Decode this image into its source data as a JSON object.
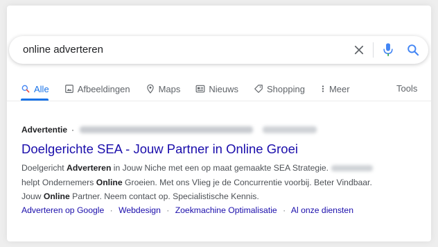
{
  "search": {
    "query": "online adverteren"
  },
  "tabs": [
    {
      "label": "Alle",
      "icon": "search-icon",
      "active": true
    },
    {
      "label": "Afbeeldingen",
      "icon": "image-icon"
    },
    {
      "label": "Maps",
      "icon": "map-pin-icon"
    },
    {
      "label": "Nieuws",
      "icon": "news-icon"
    },
    {
      "label": "Shopping",
      "icon": "tag-icon"
    },
    {
      "label": "Meer",
      "icon": "more-vert-icon"
    }
  ],
  "tools_label": "Tools",
  "ad": {
    "label": "Advertentie",
    "separator": "·",
    "title": "Doelgerichte SEA - Jouw Partner in Online Groei",
    "desc": {
      "p1": "Doelgericht ",
      "b1": "Adverteren",
      "p2": " in Jouw Niche met een op maat gemaakte SEA Strategie.",
      "p3": "helpt Ondernemers ",
      "b2": "Online",
      "p4": " Groeien. Met ons Vlieg je de Concurrentie voorbij. Beter Vindbaar.",
      "p5": "Jouw ",
      "b3": "Online",
      "p6": " Partner. Neem contact op. Specialistische Kennis."
    },
    "sitelinks": [
      "Adverteren op Google",
      "Webdesign",
      "Zoekmachine Optimalisatie",
      "Al onze diensten"
    ],
    "sitelink_separator": "·"
  },
  "colors": {
    "accent": "#1a73e8",
    "link": "#1a0dab",
    "mic_blue": "#4285f4",
    "mic_red": "#ea4335",
    "mic_yellow": "#fbbc04",
    "mic_green": "#34a853"
  }
}
